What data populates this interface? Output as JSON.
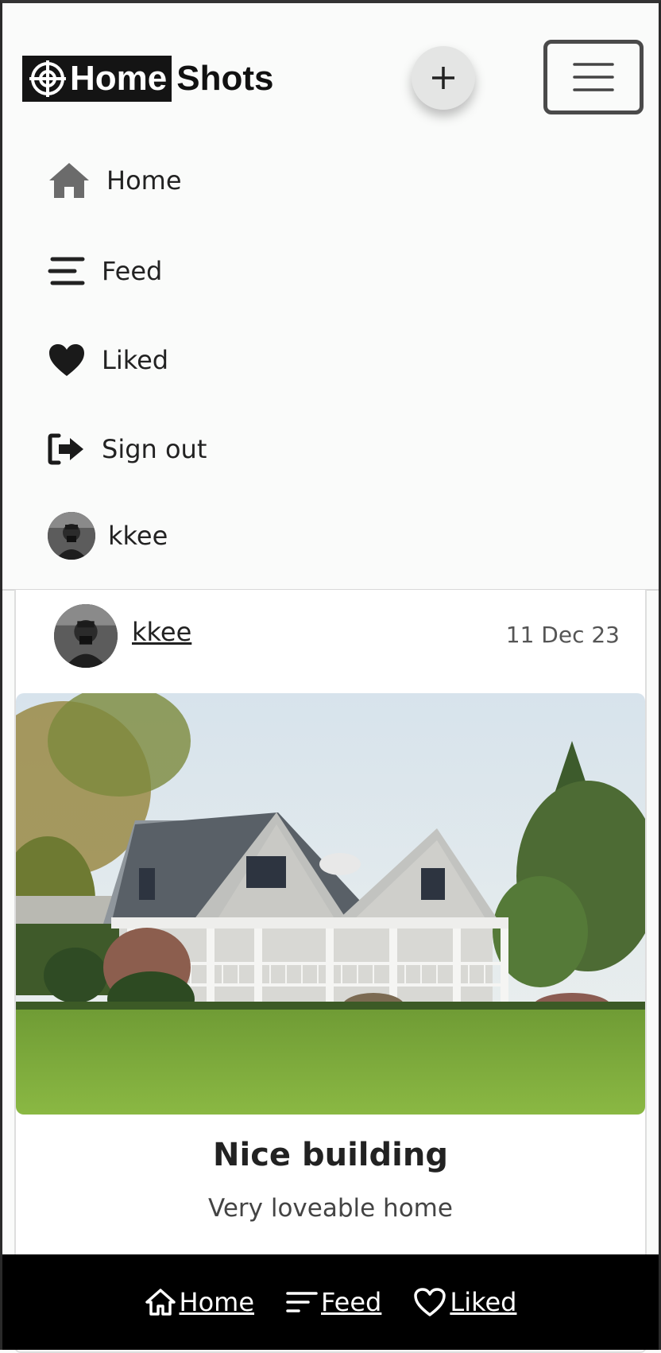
{
  "brand": {
    "part1": "Home",
    "part2": "Shots"
  },
  "header": {
    "add_button_symbol": "+",
    "nav": [
      {
        "label": "Home",
        "icon": "house-icon"
      },
      {
        "label": "Feed",
        "icon": "feed-lines-icon"
      },
      {
        "label": "Liked",
        "icon": "heart-icon"
      },
      {
        "label": "Sign out",
        "icon": "sign-out-icon"
      }
    ],
    "profile_name": "kkee"
  },
  "post": {
    "username": "kkee",
    "date": "11 Dec 23",
    "title": "Nice building",
    "description": "Very loveable home",
    "image": "house-photo"
  },
  "footer": {
    "links": [
      {
        "label": "Home",
        "icon": "house-outline-icon"
      },
      {
        "label": "Feed",
        "icon": "feed-lines-icon"
      },
      {
        "label": "Liked",
        "icon": "heart-outline-icon"
      }
    ]
  },
  "colors": {
    "background": "#fafbfa",
    "footer": "#000000",
    "text": "#222222"
  }
}
